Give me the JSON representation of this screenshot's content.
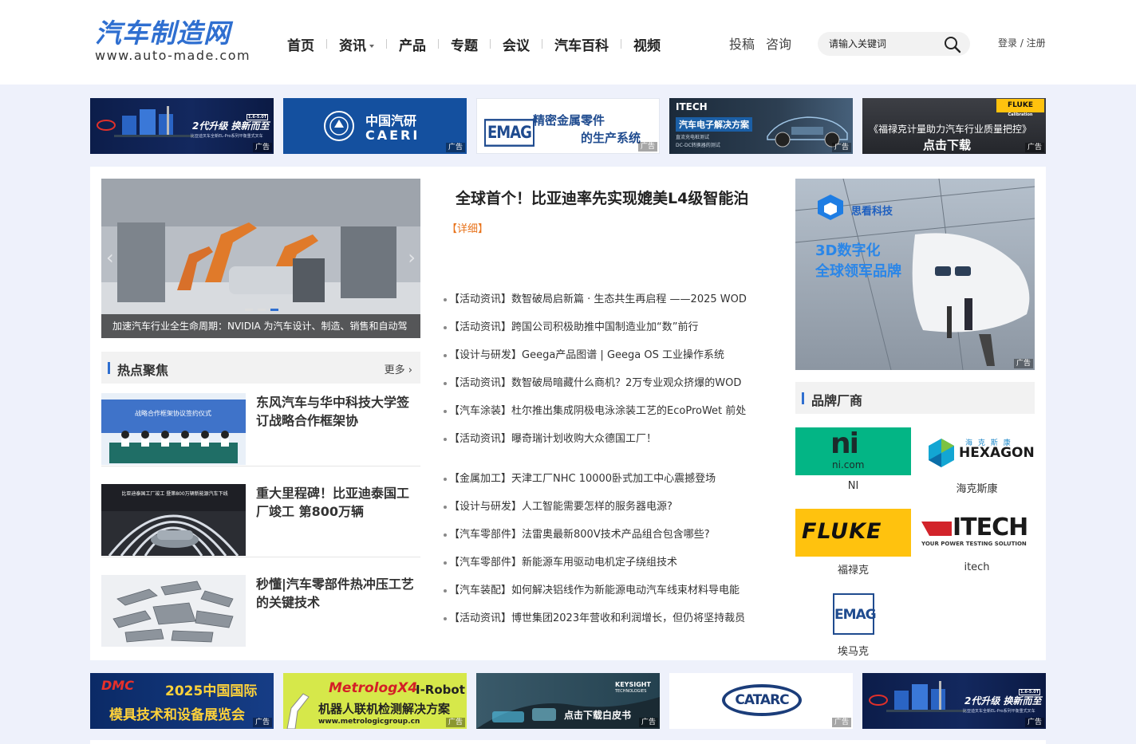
{
  "header": {
    "logo_cn": "汽车制造网",
    "logo_en": "www.auto-made.com",
    "nav": [
      {
        "label": "首页"
      },
      {
        "label": "资讯",
        "dropdown": true
      },
      {
        "label": "产品"
      },
      {
        "label": "专题"
      },
      {
        "label": "会议"
      },
      {
        "label": "汽车百科"
      },
      {
        "label": "视频"
      }
    ],
    "sublinks": [
      "投稿",
      "咨询"
    ],
    "search_placeholder": "请输入关键词",
    "login": "登录 / 注册"
  },
  "ad_tag": "广告",
  "top_ads": [
    {
      "name": "byd-ad",
      "text": "2代升级 换新而至",
      "sub": "比亚迪叉车全新EL-Pro系列平衡重式叉车",
      "tag": "1.6-5.0T"
    },
    {
      "name": "caeri-ad",
      "text": "中国汽研",
      "sub": "CAERI"
    },
    {
      "name": "emag-ad",
      "text": "精密金属零件",
      "sub": "的生产系统",
      "brand": "EMAG"
    },
    {
      "name": "itech-ad",
      "text": "汽车电子解决方案",
      "sub": "直流充电桩测试",
      "sub2": "DC-DC转换器的测试",
      "brand": "ITECH"
    },
    {
      "name": "fluke-ad",
      "text": "《福禄克计量助力汽车行业质量把控》",
      "sub": "点击下载",
      "brand": "FLUKE",
      "brand_sub": "Calibration"
    }
  ],
  "slider": {
    "caption": "加速汽车行业全生命周期：NVIDIA 为汽车设计、制造、销售和自动驾",
    "dots": 3,
    "active_dot": 3
  },
  "hot": {
    "title": "热点聚焦",
    "more": "更多",
    "items": [
      {
        "title": "东风汽车与华中科技大学签订战略合作框架协",
        "thumb": "signing-ceremony",
        "thumb_text": "战略合作框架协议签约仪式"
      },
      {
        "title": "重大里程碑！比亚迪泰国工厂竣工 第800万辆",
        "thumb": "byd-factory",
        "thumb_text": "比亚迪泰国工厂竣工 暨第800万辆新能源汽车下线"
      },
      {
        "title": "秒懂|汽车零部件热冲压工艺的关键技术",
        "thumb": "car-parts"
      }
    ]
  },
  "headline": {
    "title": "全球首个！比亚迪率先实现媲美L4级智能泊",
    "detail": "【详细】"
  },
  "news_group1": [
    {
      "tag": "【活动资讯】",
      "text": "数智破局启新篇 · 生态共生再启程 ——2025 WOD"
    },
    {
      "tag": "【活动资讯】",
      "text": "跨国公司积极助推中国制造业加“数”前行"
    },
    {
      "tag": "【设计与研发】",
      "text": "Geega产品图谱 | Geega OS 工业操作系统"
    },
    {
      "tag": "【活动资讯】",
      "text": "数智破局暗藏什么商机？2万专业观众挤爆的WOD"
    },
    {
      "tag": "【汽车涂装】",
      "text": "杜尔推出集成阴极电泳涂装工艺的EcoProWet 前处"
    },
    {
      "tag": "【活动资讯】",
      "text": "曝奇瑞计划收购大众德国工厂！"
    }
  ],
  "news_group2": [
    {
      "tag": "【金属加工】",
      "text": "天津工厂NHC 10000卧式加工中心震撼登场"
    },
    {
      "tag": "【设计与研发】",
      "text": "人工智能需要怎样的服务器电源?"
    },
    {
      "tag": "【汽车零部件】",
      "text": "法雷奥最新800V技术产品组合包含哪些?"
    },
    {
      "tag": "【汽车零部件】",
      "text": "新能源车用驱动电机定子绕组技术"
    },
    {
      "tag": "【汽车装配】",
      "text": "如何解决铝线作为新能源电动汽车线束材料导电能"
    },
    {
      "tag": "【活动资讯】",
      "text": "博世集团2023年营收和利润增长，但仍将坚持裁员"
    }
  ],
  "side_ad": {
    "brand": "思看科技",
    "line1": "3D数字化",
    "line2": "全球领军品牌"
  },
  "brands": {
    "title": "品牌厂商",
    "items": [
      {
        "name": "NI",
        "logo_text": "ni",
        "logo_sub": "ni.com",
        "color": "#03b585"
      },
      {
        "name": "海克斯康",
        "logo_text": "HEXAGON",
        "logo_sub": "海 克 斯 康",
        "color": "#ffffff"
      },
      {
        "name": "福禄克",
        "logo_text": "FLUKE",
        "color": "#ffc20e"
      },
      {
        "name": "itech",
        "logo_text": "ITECH",
        "logo_sub": "YOUR POWER TESTING SOLUTION",
        "color": "#ffffff"
      },
      {
        "name": "埃马克",
        "logo_text": "EMAG",
        "color": "#ffffff"
      }
    ]
  },
  "bottom_ads": [
    {
      "name": "dmc-ad",
      "text": "2025中国国际",
      "sub": "模具技术和设备展览会",
      "brand": "DMC"
    },
    {
      "name": "metrologic-ad",
      "text": "机器人联机检测解决方案",
      "brand": "MetrologX4",
      "brand2": "I-Robot",
      "sub": "www.metrologicgroup.cn"
    },
    {
      "name": "keysight-ad",
      "text": "点击下载白皮书",
      "brand": "KEYSIGHT",
      "brand_sub": "TECHNOLOGIES"
    },
    {
      "name": "catarc-ad",
      "brand": "CATARC"
    },
    {
      "name": "byd-ad-2",
      "text": "2代升级 换新而至",
      "sub": "比亚迪叉车全新EL-Pro系列平衡重式叉车",
      "tag": "1.6-5.0T"
    }
  ]
}
